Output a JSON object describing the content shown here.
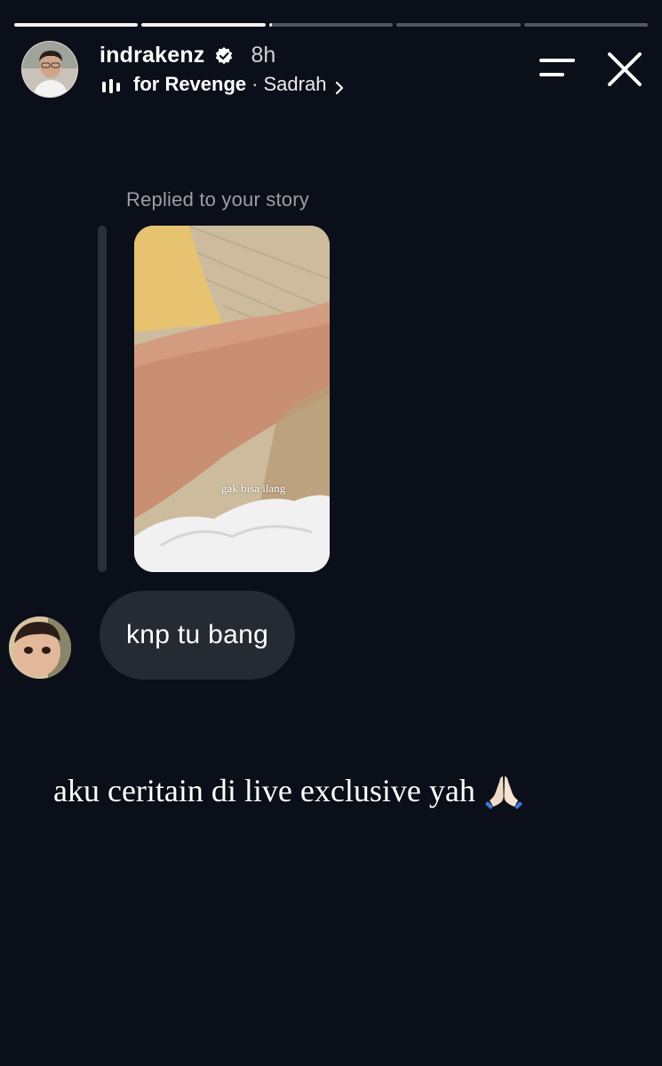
{
  "progress": [
    {
      "fill": 1.0
    },
    {
      "fill": 1.0
    },
    {
      "fill": 0.02
    },
    {
      "fill": 0
    },
    {
      "fill": 0
    }
  ],
  "header": {
    "username": "indrakenz",
    "time": "8h",
    "song": "for Revenge",
    "separator": "·",
    "artist": "Sadrah"
  },
  "reply": {
    "label": "Replied to your story",
    "story_caption": "gak bisa ilang",
    "message": "knp tu bang"
  },
  "caption": {
    "text": "aku ceritain di live exclusive yah"
  },
  "colors": {
    "background": "#0b0f19",
    "bubble": "#262a33",
    "reply_bar": "#2b2f38",
    "label": "#9a9ea6",
    "verified": "#ffffff"
  },
  "icons": [
    "verified-icon",
    "music-bars-icon",
    "chevron-right-icon",
    "menu-icon",
    "close-icon",
    "pray-hands-icon"
  ]
}
